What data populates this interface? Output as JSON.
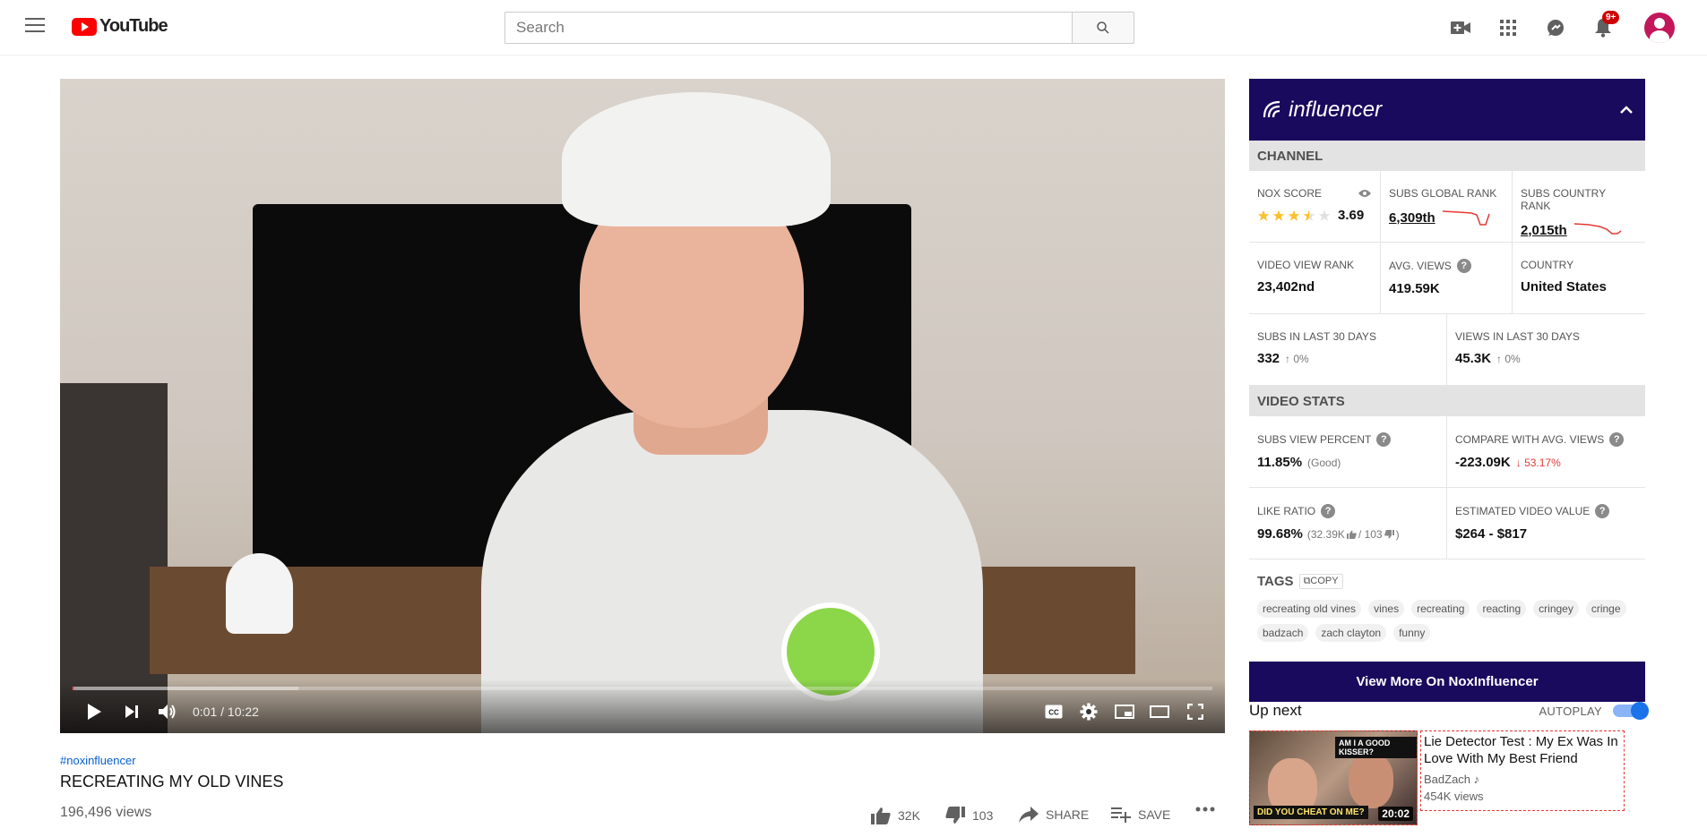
{
  "header": {
    "logo_text": "YouTube",
    "search_placeholder": "Search",
    "notification_count": "9+"
  },
  "player": {
    "time_current": "0:01",
    "time_separator": " / ",
    "time_total": "10:22",
    "progress_fraction": 0.0016
  },
  "video": {
    "hashtag": "#noxinfluencer",
    "title": "RECREATING MY OLD VINES",
    "views": "196,496 views",
    "likes": "32K",
    "dislikes": "103",
    "share_label": "SHARE",
    "save_label": "SAVE"
  },
  "panel": {
    "logo_text": "influencer",
    "channel_heading": "CHANNEL",
    "nox_score_label": "NOX SCORE",
    "nox_score_value": "3.69",
    "nox_stars": 3.5,
    "subs_global_rank_label": "SUBS GLOBAL RANK",
    "subs_global_rank_value": "6,309th",
    "subs_country_rank_label": "SUBS COUNTRY RANK",
    "subs_country_rank_value": "2,015th",
    "video_view_rank_label": "VIDEO VIEW RANK",
    "video_view_rank_value": "23,402nd",
    "avg_views_label": "AVG. VIEWS",
    "avg_views_value": "419.59K",
    "country_label": "COUNTRY",
    "country_value": "United States",
    "subs_30_label": "SUBS IN LAST 30 DAYS",
    "subs_30_value": "332",
    "subs_30_change": "0%",
    "views_30_label": "VIEWS IN LAST 30 DAYS",
    "views_30_value": "45.3K",
    "views_30_change": "0%",
    "video_stats_heading": "VIDEO STATS",
    "subs_view_percent_label": "SUBS VIEW PERCENT",
    "subs_view_percent_value": "11.85%",
    "subs_view_percent_note": "(Good)",
    "compare_label": "COMPARE WITH AVG. VIEWS",
    "compare_value": "-223.09K",
    "compare_change": "53.17%",
    "like_ratio_label": "LIKE RATIO",
    "like_ratio_value": "99.68%",
    "like_ratio_open": "(32.39K",
    "like_ratio_mid": "/ 103",
    "like_ratio_close": ")",
    "est_value_label": "ESTIMATED VIDEO VALUE",
    "est_value_value": "$264 - $817",
    "tags_heading": "TAGS",
    "copy_label": "COPY",
    "tags": [
      "recreating old vines",
      "vines",
      "recreating",
      "reacting",
      "cringey",
      "cringe",
      "badzach",
      "zach clayton",
      "funny"
    ],
    "view_more_label": "View More On NoxInfluencer",
    "accent_color": "#1a0a5e"
  },
  "upnext": {
    "label": "Up next",
    "autoplay_label": "AUTOPLAY",
    "autoplay_on": true,
    "item": {
      "title": "Lie Detector Test : My Ex Was In Love With My Best Friend",
      "channel": "BadZach",
      "views": "454K views",
      "duration": "20:02",
      "thumb_text_top": "AM I A GOOD KISSER?",
      "thumb_text_bottom": "DID YOU CHEAT ON ME?"
    }
  }
}
